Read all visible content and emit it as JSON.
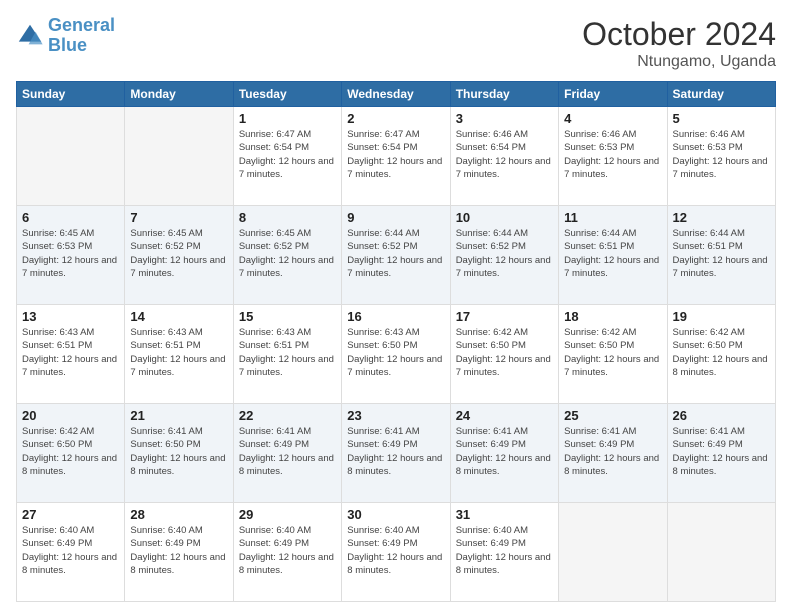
{
  "header": {
    "logo_line1": "General",
    "logo_line2": "Blue",
    "month": "October 2024",
    "location": "Ntungamo, Uganda"
  },
  "weekdays": [
    "Sunday",
    "Monday",
    "Tuesday",
    "Wednesday",
    "Thursday",
    "Friday",
    "Saturday"
  ],
  "weeks": [
    [
      {
        "day": "",
        "empty": true
      },
      {
        "day": "",
        "empty": true
      },
      {
        "day": "1",
        "sunrise": "6:47 AM",
        "sunset": "6:54 PM",
        "daylight": "12 hours and 7 minutes."
      },
      {
        "day": "2",
        "sunrise": "6:47 AM",
        "sunset": "6:54 PM",
        "daylight": "12 hours and 7 minutes."
      },
      {
        "day": "3",
        "sunrise": "6:46 AM",
        "sunset": "6:54 PM",
        "daylight": "12 hours and 7 minutes."
      },
      {
        "day": "4",
        "sunrise": "6:46 AM",
        "sunset": "6:53 PM",
        "daylight": "12 hours and 7 minutes."
      },
      {
        "day": "5",
        "sunrise": "6:46 AM",
        "sunset": "6:53 PM",
        "daylight": "12 hours and 7 minutes."
      }
    ],
    [
      {
        "day": "6",
        "sunrise": "6:45 AM",
        "sunset": "6:53 PM",
        "daylight": "12 hours and 7 minutes."
      },
      {
        "day": "7",
        "sunrise": "6:45 AM",
        "sunset": "6:52 PM",
        "daylight": "12 hours and 7 minutes."
      },
      {
        "day": "8",
        "sunrise": "6:45 AM",
        "sunset": "6:52 PM",
        "daylight": "12 hours and 7 minutes."
      },
      {
        "day": "9",
        "sunrise": "6:44 AM",
        "sunset": "6:52 PM",
        "daylight": "12 hours and 7 minutes."
      },
      {
        "day": "10",
        "sunrise": "6:44 AM",
        "sunset": "6:52 PM",
        "daylight": "12 hours and 7 minutes."
      },
      {
        "day": "11",
        "sunrise": "6:44 AM",
        "sunset": "6:51 PM",
        "daylight": "12 hours and 7 minutes."
      },
      {
        "day": "12",
        "sunrise": "6:44 AM",
        "sunset": "6:51 PM",
        "daylight": "12 hours and 7 minutes."
      }
    ],
    [
      {
        "day": "13",
        "sunrise": "6:43 AM",
        "sunset": "6:51 PM",
        "daylight": "12 hours and 7 minutes."
      },
      {
        "day": "14",
        "sunrise": "6:43 AM",
        "sunset": "6:51 PM",
        "daylight": "12 hours and 7 minutes."
      },
      {
        "day": "15",
        "sunrise": "6:43 AM",
        "sunset": "6:51 PM",
        "daylight": "12 hours and 7 minutes."
      },
      {
        "day": "16",
        "sunrise": "6:43 AM",
        "sunset": "6:50 PM",
        "daylight": "12 hours and 7 minutes."
      },
      {
        "day": "17",
        "sunrise": "6:42 AM",
        "sunset": "6:50 PM",
        "daylight": "12 hours and 7 minutes."
      },
      {
        "day": "18",
        "sunrise": "6:42 AM",
        "sunset": "6:50 PM",
        "daylight": "12 hours and 7 minutes."
      },
      {
        "day": "19",
        "sunrise": "6:42 AM",
        "sunset": "6:50 PM",
        "daylight": "12 hours and 8 minutes."
      }
    ],
    [
      {
        "day": "20",
        "sunrise": "6:42 AM",
        "sunset": "6:50 PM",
        "daylight": "12 hours and 8 minutes."
      },
      {
        "day": "21",
        "sunrise": "6:41 AM",
        "sunset": "6:50 PM",
        "daylight": "12 hours and 8 minutes."
      },
      {
        "day": "22",
        "sunrise": "6:41 AM",
        "sunset": "6:49 PM",
        "daylight": "12 hours and 8 minutes."
      },
      {
        "day": "23",
        "sunrise": "6:41 AM",
        "sunset": "6:49 PM",
        "daylight": "12 hours and 8 minutes."
      },
      {
        "day": "24",
        "sunrise": "6:41 AM",
        "sunset": "6:49 PM",
        "daylight": "12 hours and 8 minutes."
      },
      {
        "day": "25",
        "sunrise": "6:41 AM",
        "sunset": "6:49 PM",
        "daylight": "12 hours and 8 minutes."
      },
      {
        "day": "26",
        "sunrise": "6:41 AM",
        "sunset": "6:49 PM",
        "daylight": "12 hours and 8 minutes."
      }
    ],
    [
      {
        "day": "27",
        "sunrise": "6:40 AM",
        "sunset": "6:49 PM",
        "daylight": "12 hours and 8 minutes."
      },
      {
        "day": "28",
        "sunrise": "6:40 AM",
        "sunset": "6:49 PM",
        "daylight": "12 hours and 8 minutes."
      },
      {
        "day": "29",
        "sunrise": "6:40 AM",
        "sunset": "6:49 PM",
        "daylight": "12 hours and 8 minutes."
      },
      {
        "day": "30",
        "sunrise": "6:40 AM",
        "sunset": "6:49 PM",
        "daylight": "12 hours and 8 minutes."
      },
      {
        "day": "31",
        "sunrise": "6:40 AM",
        "sunset": "6:49 PM",
        "daylight": "12 hours and 8 minutes."
      },
      {
        "day": "",
        "empty": true
      },
      {
        "day": "",
        "empty": true
      }
    ]
  ]
}
